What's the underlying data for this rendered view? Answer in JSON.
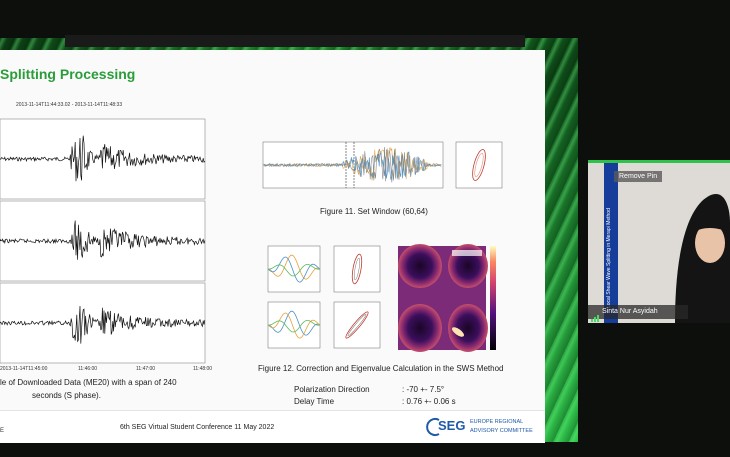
{
  "slide": {
    "title": "Splitting Processing",
    "time_range": "2013-11-14T11:44:33.02  -  2013-11-14T11:48:33",
    "time_ticks": [
      "11:45:00",
      "11:46:00",
      "11:47:00",
      "11:48:00"
    ],
    "time_tick_first": "2013-11-14T11:45:00",
    "fig_left_caption_line1": "le of Downloaded Data (ME20) with a span of 240",
    "fig_left_caption_line2": "seconds (S phase).",
    "fig11_caption": "Figure 11. Set Window (60,64)",
    "fig12_caption": "Figure 12. Correction and Eigenvalue Calculation in the SWS Method",
    "pol_label": "Polarization Direction",
    "pol_value": ": -70 +- 7.5°",
    "delay_label": "Delay Time",
    "delay_value": ": 0.76 +- 0.06 s",
    "footer_text": "6th SEG Virtual Student Conference 11 May 2022",
    "footer_logo": "SEG",
    "footer_org_line1": "EUROPE REGIONAL",
    "footer_org_line2": "ADVISORY COMMITTEE",
    "footer_left": "E"
  },
  "video": {
    "overlay_button": "Remove Pin",
    "participant_name": "Sinta Nur Asyidah",
    "rotated_text": "Local Shear Wave Splitting in Merapi Method"
  },
  "colors": {
    "accent_green": "#2ec24a",
    "title_green": "#2a9d3a"
  }
}
